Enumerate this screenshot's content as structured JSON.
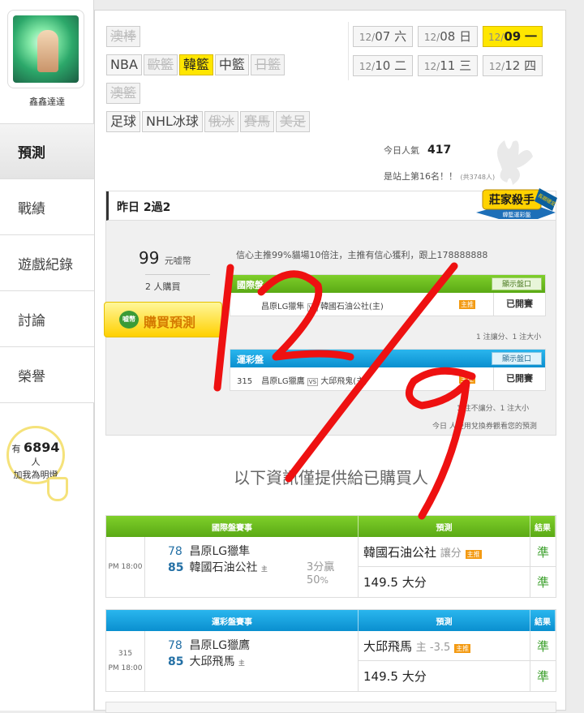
{
  "sidebar": {
    "username": "鑫鑫達達",
    "nav": [
      "預測",
      "戰績",
      "遊戲紀錄",
      "討論",
      "榮譽"
    ],
    "fans_prefix": "有",
    "fans_count": "6894",
    "fans_suffix": "人",
    "fans_text": "加我為明燈"
  },
  "sports": {
    "row1": [
      "澳棒"
    ],
    "row2": [
      "NBA",
      "歐籃",
      "韓籃",
      "中籃",
      "日籃"
    ],
    "row3": [
      "澳籃"
    ],
    "row4": [
      "足球",
      "NHL冰球",
      "俄冰",
      "賽馬",
      "美足"
    ]
  },
  "dates": [
    {
      "md": "12/",
      "d": "07",
      "w": "六"
    },
    {
      "md": "12/",
      "d": "08",
      "w": "日"
    },
    {
      "md": "12/",
      "d": "09",
      "w": "一"
    },
    {
      "md": "12/",
      "d": "10",
      "w": "二"
    },
    {
      "md": "12/",
      "d": "11",
      "w": "三"
    },
    {
      "md": "12/",
      "d": "12",
      "w": "四"
    }
  ],
  "popularity": {
    "label": "今日人氣",
    "value": "417",
    "rank_text": "是站上第16名！！",
    "rank_total": "(共3748人)"
  },
  "badge": {
    "title": "莊家殺手",
    "sub": "韓籃運彩盤",
    "corner": "長期穩定"
  },
  "card": {
    "header": "昨日 2過2",
    "price": "99",
    "price_unit": "元嘘幣",
    "buyers": "2 人購買",
    "buy_button": "購買預測",
    "buy_icon": "嘘幣",
    "description": "信心主推99%貓場10倍注，主推有信心獲利，跟上178888888",
    "intl": {
      "title": "國際盤",
      "show_btn": "顯示盤口",
      "home": "昌原LG獵隼",
      "vs": "VS",
      "away": "韓國石油公社(主)",
      "tag": "主推",
      "status": "已開賽",
      "note": "1 注讓分、1 注大小"
    },
    "sport": {
      "title": "運彩盤",
      "show_btn": "顯示盤口",
      "id": "315",
      "home": "昌原LG獵鷹",
      "vs": "VS",
      "away": "大邱飛鬼(主)",
      "tag": "主推",
      "status": "已開賽",
      "note": "1 注不讓分、1 注大小"
    },
    "note_bottom": "今日 人使用兌換券觀看您的預測"
  },
  "info_text": "以下資訊僅提供給已購買人",
  "tables": [
    {
      "theme": "green",
      "headers": [
        "國際盤賽事",
        "預測",
        "結果"
      ],
      "time": "PM 18:00",
      "id": "",
      "team1_num": "78",
      "team1": "昌原LG獵隼",
      "team2_num": "85",
      "team2": "韓國石油公社",
      "home_mark": "主",
      "odds_line1": "3分贏",
      "odds_line2": "50",
      "odds_pct": "%",
      "pred1": "韓國石油公社",
      "pred1_extra": "讓分",
      "pred1_tag": "主推",
      "pred2": "149.5 大分",
      "res1": "準",
      "res2": "準"
    },
    {
      "theme": "blue",
      "headers": [
        "運彩盤賽事",
        "預測",
        "結果"
      ],
      "time": "PM 18:00",
      "id": "315",
      "team1_num": "78",
      "team1": "昌原LG獵鷹",
      "team2_num": "85",
      "team2": "大邱飛馬",
      "home_mark": "主",
      "odds_line1": "",
      "odds_line2": "",
      "odds_pct": "",
      "pred1": "大邱飛馬",
      "pred1_extra": "主 -3.5",
      "pred1_tag": "主推",
      "pred2": "149.5 大分",
      "res1": "準",
      "res2": "準"
    }
  ],
  "colors": {
    "accent_yellow": "#ffe600",
    "green": "#5aa915",
    "blue": "#0a8fcf",
    "scribble": "#ee1111"
  }
}
